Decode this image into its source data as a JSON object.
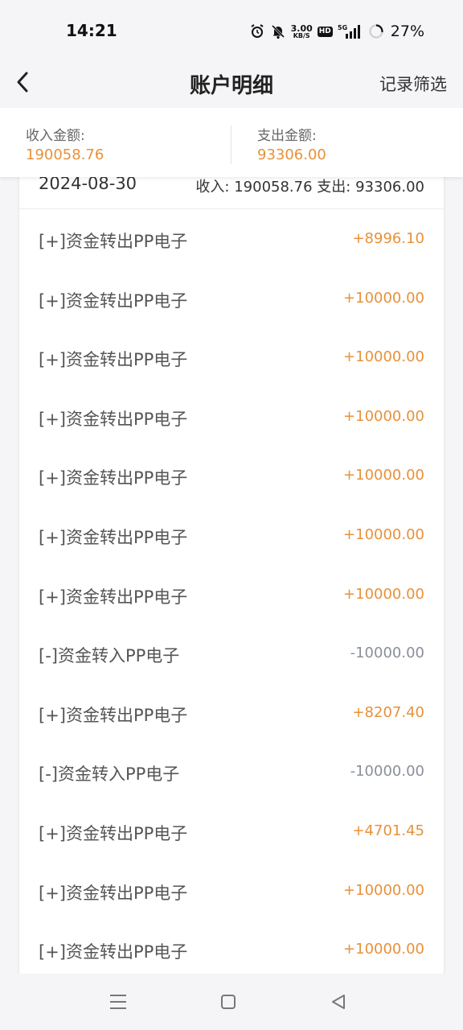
{
  "status_bar": {
    "time": "14:21",
    "speed_value": "3.00",
    "speed_unit": "KB/S",
    "hd_label": "HD",
    "network_label": "5G",
    "battery_percent": "27%",
    "battery_level": 0.27,
    "icons": [
      "alarm-icon",
      "mute-bell-icon",
      "signal-icon",
      "battery-ring-icon"
    ]
  },
  "header": {
    "title": "账户明细",
    "filter_label": "记录筛选",
    "back_icon": "chevron-left-icon"
  },
  "summary": {
    "income_label": "收入金额:",
    "income_value": "190058.76",
    "expense_label": "支出金额:",
    "expense_value": "93306.00"
  },
  "day_group": {
    "date": "2024-08-30",
    "income_label": "收入:",
    "income_value": "190058.76",
    "expense_label": "支出:",
    "expense_value": "93306.00"
  },
  "transactions": [
    {
      "title": "[+]资金转出PP电子",
      "amount": "+8996.10",
      "type": "pos"
    },
    {
      "title": "[+]资金转出PP电子",
      "amount": "+10000.00",
      "type": "pos"
    },
    {
      "title": "[+]资金转出PP电子",
      "amount": "+10000.00",
      "type": "pos"
    },
    {
      "title": "[+]资金转出PP电子",
      "amount": "+10000.00",
      "type": "pos"
    },
    {
      "title": "[+]资金转出PP电子",
      "amount": "+10000.00",
      "type": "pos"
    },
    {
      "title": "[+]资金转出PP电子",
      "amount": "+10000.00",
      "type": "pos"
    },
    {
      "title": "[+]资金转出PP电子",
      "amount": "+10000.00",
      "type": "pos"
    },
    {
      "title": "[-]资金转入PP电子",
      "amount": "-10000.00",
      "type": "neg"
    },
    {
      "title": "[+]资金转出PP电子",
      "amount": "+8207.40",
      "type": "pos"
    },
    {
      "title": "[-]资金转入PP电子",
      "amount": "-10000.00",
      "type": "neg"
    },
    {
      "title": "[+]资金转出PP电子",
      "amount": "+4701.45",
      "type": "pos"
    },
    {
      "title": "[+]资金转出PP电子",
      "amount": "+10000.00",
      "type": "pos"
    },
    {
      "title": "[+]资金转出PP电子",
      "amount": "+10000.00",
      "type": "pos"
    }
  ],
  "colors": {
    "income_accent": "#e8913a",
    "expense_gray": "#8a8f99",
    "background": "#f5f5f7",
    "card": "#ffffff"
  },
  "system_nav": {
    "icons": [
      "menu-icon",
      "home-square-icon",
      "back-triangle-icon"
    ]
  }
}
